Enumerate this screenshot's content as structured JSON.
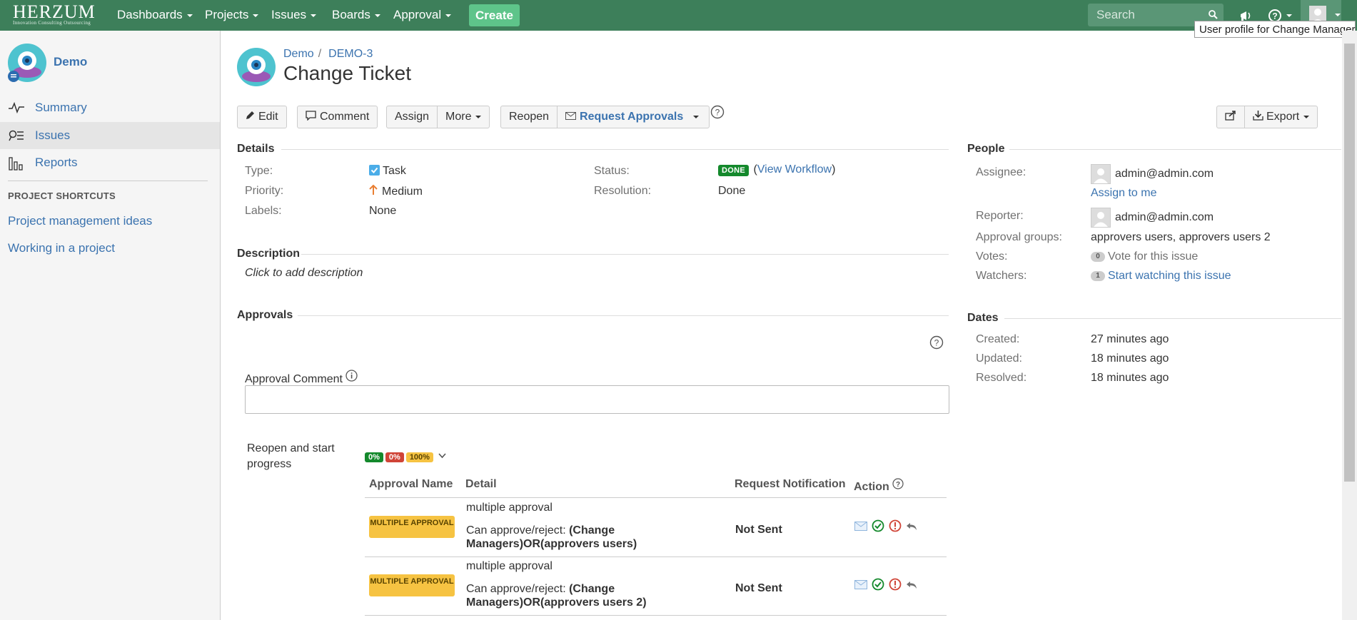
{
  "brand": {
    "name": "HERZUM",
    "tagline": "Innovation Consulting Outsourcing"
  },
  "topnav": {
    "items": [
      "Dashboards",
      "Projects",
      "Issues",
      "Boards",
      "Approval"
    ],
    "create_label": "Create",
    "search_placeholder": "Search",
    "tooltip": "User profile for Change Manager"
  },
  "sidebar": {
    "project_name": "Demo",
    "nav": [
      "Summary",
      "Issues",
      "Reports"
    ],
    "shortcuts_heading": "PROJECT SHORTCUTS",
    "shortcuts": [
      "Project management ideas",
      "Working in a project"
    ]
  },
  "issue": {
    "breadcrumb_project": "Demo",
    "breadcrumb_sep": "/",
    "key": "DEMO-3",
    "title": "Change Ticket"
  },
  "toolbar": {
    "edit": "Edit",
    "comment": "Comment",
    "assign": "Assign",
    "more": "More",
    "reopen": "Reopen",
    "request_approvals": "Request Approvals",
    "export": "Export"
  },
  "details": {
    "heading": "Details",
    "type_label": "Type:",
    "type_value": "Task",
    "priority_label": "Priority:",
    "priority_value": "Medium",
    "labels_label": "Labels:",
    "labels_value": "None",
    "status_label": "Status:",
    "status_value": "DONE",
    "view_workflow_open": "(",
    "view_workflow": "View Workflow",
    "view_workflow_close": ")",
    "resolution_label": "Resolution:",
    "resolution_value": "Done"
  },
  "description": {
    "heading": "Description",
    "placeholder": "Click to add description"
  },
  "approvals": {
    "heading": "Approvals",
    "comment_label": "Approval Comment",
    "transition": "Reopen and start progress",
    "pcts": [
      "0%",
      "0%",
      "100%"
    ],
    "columns": [
      "Approval Name",
      "Detail",
      "Request Notification",
      "Action"
    ],
    "rows": [
      {
        "badge": "MULTIPLE APPROVAL",
        "title": "multiple approval",
        "can": "Can approve/reject:",
        "who": "(Change Managers)OR(approvers users)",
        "notification": "Not Sent"
      },
      {
        "badge": "MULTIPLE APPROVAL",
        "title": "multiple approval",
        "can": "Can approve/reject:",
        "who": "(Change Managers)OR(approvers users 2)",
        "notification": "Not Sent"
      }
    ]
  },
  "people": {
    "heading": "People",
    "assignee_label": "Assignee:",
    "assignee": "admin@admin.com",
    "assign_to_me": "Assign to me",
    "reporter_label": "Reporter:",
    "reporter": "admin@admin.com",
    "groups_label": "Approval groups:",
    "groups": "approvers users, approvers users 2",
    "votes_label": "Votes:",
    "votes_count": "0",
    "vote_link": "Vote for this issue",
    "watchers_label": "Watchers:",
    "watchers_count": "1",
    "watch_link": "Start watching this issue"
  },
  "dates": {
    "heading": "Dates",
    "created_label": "Created:",
    "created": "27 minutes ago",
    "updated_label": "Updated:",
    "updated": "18 minutes ago",
    "resolved_label": "Resolved:",
    "resolved": "18 minutes ago"
  },
  "colors": {
    "nav_bg": "#3d7f5a",
    "create": "#5ec48a",
    "link": "#3b73af",
    "done": "#14892c",
    "badge": "#f6c342"
  }
}
